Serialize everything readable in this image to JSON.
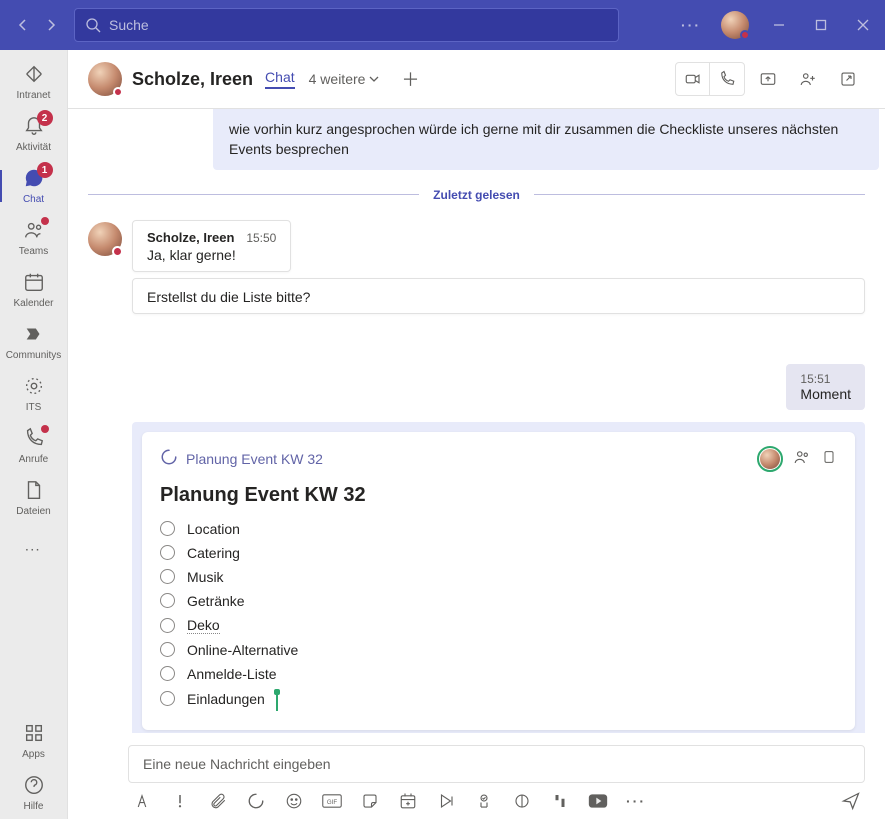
{
  "titlebar": {
    "search_placeholder": "Suche"
  },
  "sidebar": {
    "items": [
      {
        "label": "Intranet"
      },
      {
        "label": "Aktivität",
        "badge": "2"
      },
      {
        "label": "Chat",
        "badge": "1"
      },
      {
        "label": "Teams"
      },
      {
        "label": "Kalender"
      },
      {
        "label": "Communitys"
      },
      {
        "label": "ITS"
      },
      {
        "label": "Anrufe"
      },
      {
        "label": "Dateien"
      }
    ],
    "apps": "Apps",
    "help": "Hilfe"
  },
  "chat_header": {
    "title": "Scholze, Ireen",
    "tab_chat": "Chat",
    "more_count": "4 weitere"
  },
  "messages": {
    "prev": "wie vorhin kurz angesprochen würde ich gerne mit dir zusammen die Checkliste unseres nächsten Events besprechen",
    "divider": "Zuletzt gelesen",
    "m1_sender": "Scholze, Ireen",
    "m1_time": "15:50",
    "m1_text": "Ja, klar gerne!",
    "m2_text": "Erstellst du die Liste bitte?",
    "my_time": "15:51",
    "my_text": "Moment"
  },
  "loop": {
    "link": "Planung Event KW 32",
    "title": "Planung Event KW 32",
    "items": [
      "Location",
      "Catering",
      "Musik",
      "Getränke",
      "Deko",
      "Online-Alternative",
      "Anmelde-Liste",
      "Einladungen"
    ]
  },
  "compose": {
    "placeholder": "Eine neue Nachricht eingeben"
  }
}
